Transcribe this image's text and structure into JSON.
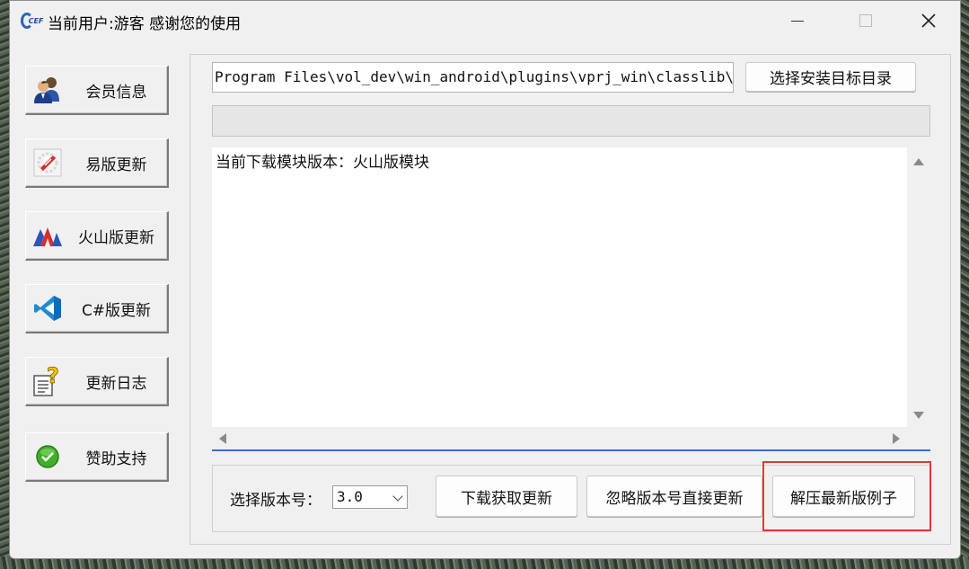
{
  "window": {
    "title": "当前用户:游客 感谢您的使用",
    "app_icon_text": "CEF"
  },
  "sidebar": {
    "items": [
      {
        "label": "会员信息",
        "icon": "users-icon"
      },
      {
        "label": "易版更新",
        "icon": "e-lang-icon"
      },
      {
        "label": "火山版更新",
        "icon": "volcano-icon"
      },
      {
        "label": "C#版更新",
        "icon": "vscode-icon"
      },
      {
        "label": "更新日志",
        "icon": "log-question-icon"
      },
      {
        "label": "赞助支持",
        "icon": "check-circle-icon"
      }
    ]
  },
  "main": {
    "path_value": "Program Files\\vol_dev\\win_android\\plugins\\vprj_win\\classlib\\sys\\",
    "choose_dir_label": "选择安装目标目录",
    "progress": 0,
    "log_text": "当前下载模块版本：火山版模块",
    "version_label": "选择版本号：",
    "version_value": "3.0",
    "download_label": "下载获取更新",
    "ignore_label": "忽略版本号直接更新",
    "extract_label": "解压最新版例子"
  },
  "colors": {
    "highlight": "#e03a3a",
    "accent": "#2f72c7"
  }
}
